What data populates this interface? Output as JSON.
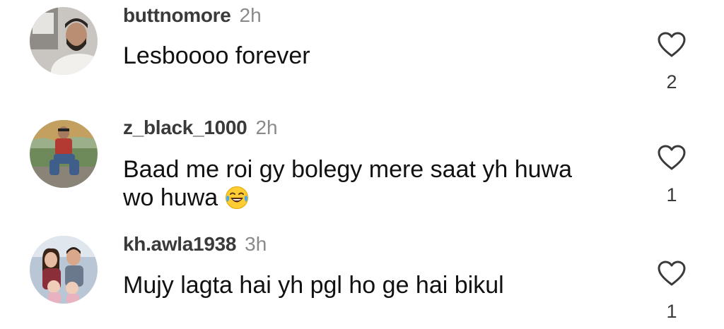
{
  "comments": [
    {
      "username": "buttnomore",
      "time": "2h",
      "text": "Lesboooo forever",
      "likes": "2",
      "avatar": "avatar-man-beard",
      "like_icon": "heart-outline-icon"
    },
    {
      "username": "z_black_1000",
      "time": "2h",
      "text": "Baad me roi gy bolegy mere saat yh huwa wo huwa",
      "emoji": "😂",
      "likes": "1",
      "avatar": "avatar-man-sitting-outdoors",
      "like_icon": "heart-outline-icon"
    },
    {
      "username": "kh.awla1938",
      "time": "3h",
      "text": "Mujy lagta hai yh pgl ho ge hai bikul",
      "likes": "1",
      "avatar": "avatar-family-portrait",
      "like_icon": "heart-outline-icon"
    }
  ],
  "colors": {
    "username": "#3a3a3a",
    "time": "#8a8a8a",
    "text": "#111111",
    "heart_stroke": "#3a3a3a"
  }
}
